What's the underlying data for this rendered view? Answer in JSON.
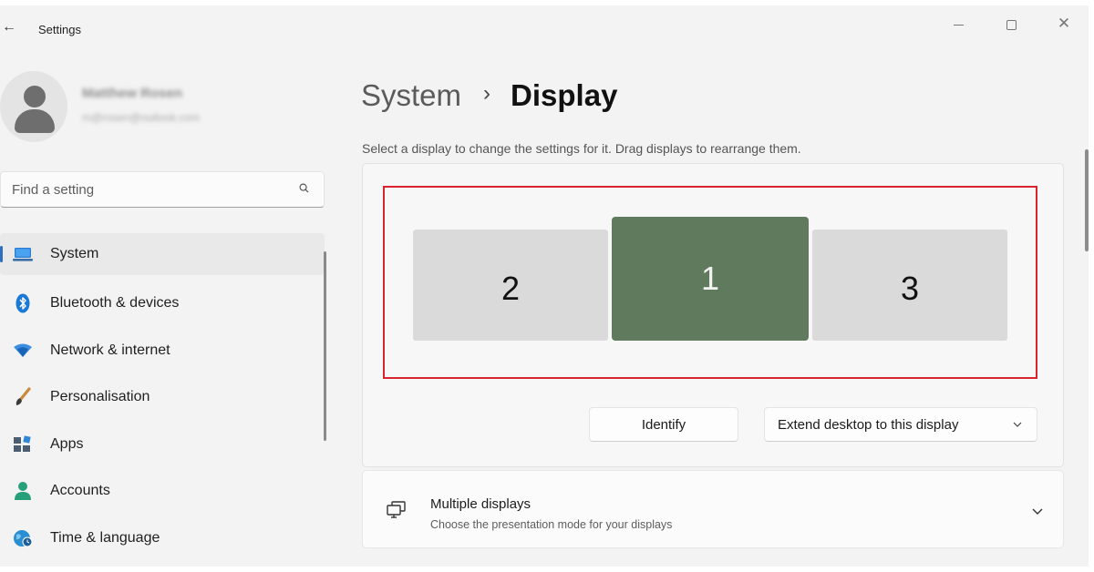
{
  "window": {
    "title": "Settings",
    "back_icon": "back-arrow-icon",
    "controls": [
      "minimize-icon",
      "maximize-icon",
      "close-icon"
    ],
    "close_glyph": "✕",
    "back_glyph": "←"
  },
  "profile": {
    "name": "Matthew Rosen",
    "email": "m@rosen@outlook.com"
  },
  "search": {
    "placeholder": "Find a setting",
    "icon": "search-icon"
  },
  "sidebar": {
    "active_index": 0,
    "items": [
      {
        "label": "System",
        "icon": "laptop-icon",
        "color": "#2d7ad6"
      },
      {
        "label": "Bluetooth & devices",
        "icon": "bluetooth-icon",
        "color": "#1b79d6"
      },
      {
        "label": "Network & internet",
        "icon": "wifi-icon",
        "color": "#3b8fe0"
      },
      {
        "label": "Personalisation",
        "icon": "brush-icon",
        "color": "#c98a3b"
      },
      {
        "label": "Apps",
        "icon": "apps-icon",
        "color": "#4a5d73"
      },
      {
        "label": "Accounts",
        "icon": "person-icon",
        "color": "#27a07a"
      },
      {
        "label": "Time & language",
        "icon": "globe-clock-icon",
        "color": "#2a8fd2"
      }
    ]
  },
  "breadcrumb": {
    "parent": "System",
    "separator": "›",
    "current": "Display"
  },
  "arrangement": {
    "instruction": "Select a display to change the settings for it. Drag displays to rearrange them.",
    "highlight_color": "#d9232e",
    "selected_display": "1",
    "selected_color": "#5f7a5d",
    "monitors": [
      "2",
      "1",
      "3"
    ]
  },
  "actions": {
    "identify_label": "Identify",
    "extend_label": "Extend desktop to this display"
  },
  "multiple_displays": {
    "title": "Multiple displays",
    "subtitle": "Choose the presentation mode for your displays",
    "icon": "multiple-displays-icon"
  }
}
